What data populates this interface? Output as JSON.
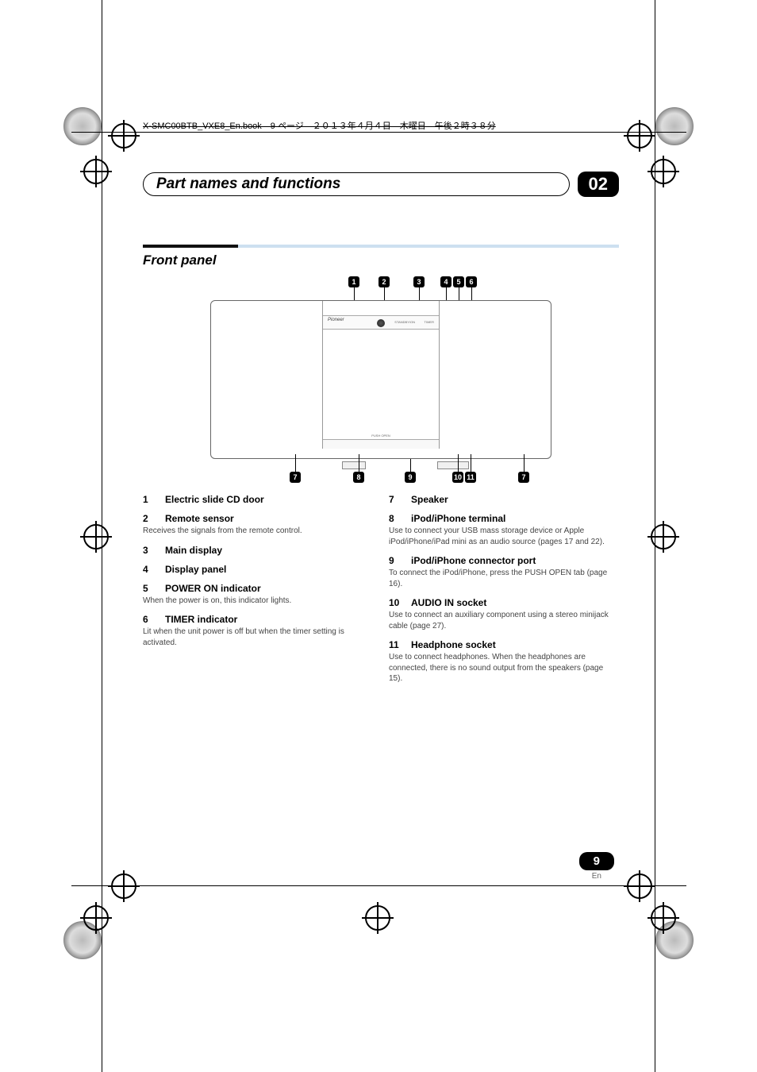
{
  "meta_line": "X-SMC00BTB_VXE8_En.book　9 ページ　２０１３年４月４日　木曜日　午後２時３８分",
  "chapter": {
    "title": "Part names and functions",
    "number": "02"
  },
  "section": {
    "title": "Front panel"
  },
  "diagram": {
    "brand": "Pioneer",
    "push_open": "PUSH OPEN",
    "label_standby": "STANDBY/ON",
    "label_timer": "TIMER",
    "top_callouts": [
      "1",
      "2",
      "3",
      "4",
      "5",
      "6"
    ],
    "bottom_callouts": [
      "7",
      "8",
      "9",
      "10",
      "11",
      "7"
    ]
  },
  "left_items": [
    {
      "num": "1",
      "title": "Electric slide CD door",
      "body": ""
    },
    {
      "num": "2",
      "title": "Remote sensor",
      "body": "Receives the signals from the remote control."
    },
    {
      "num": "3",
      "title": "Main display",
      "body": ""
    },
    {
      "num": "4",
      "title": "Display panel",
      "body": ""
    },
    {
      "num": "5",
      "title": "POWER ON indicator",
      "body": "When the power is on, this indicator lights."
    },
    {
      "num": "6",
      "title": "TIMER indicator",
      "body": "Lit when the unit power is off but when the timer setting is activated."
    }
  ],
  "right_items": [
    {
      "num": "7",
      "title": "Speaker",
      "body": ""
    },
    {
      "num": "8",
      "title": "iPod/iPhone terminal",
      "body": "Use to connect your USB mass storage device or Apple iPod/iPhone/iPad mini as an audio source (pages 17 and 22)."
    },
    {
      "num": "9",
      "title": "iPod/iPhone connector port",
      "body": "To connect the iPod/iPhone, press the PUSH OPEN tab (page 16)."
    },
    {
      "num": "10",
      "title": "AUDIO IN socket",
      "body": "Use to connect an auxiliary component using a stereo minijack cable (page 27)."
    },
    {
      "num": "11",
      "title": "Headphone socket",
      "body": "Use to connect headphones. When the headphones are connected, there is no sound output from the speakers (page 15)."
    }
  ],
  "footer": {
    "page": "9",
    "lang": "En"
  }
}
